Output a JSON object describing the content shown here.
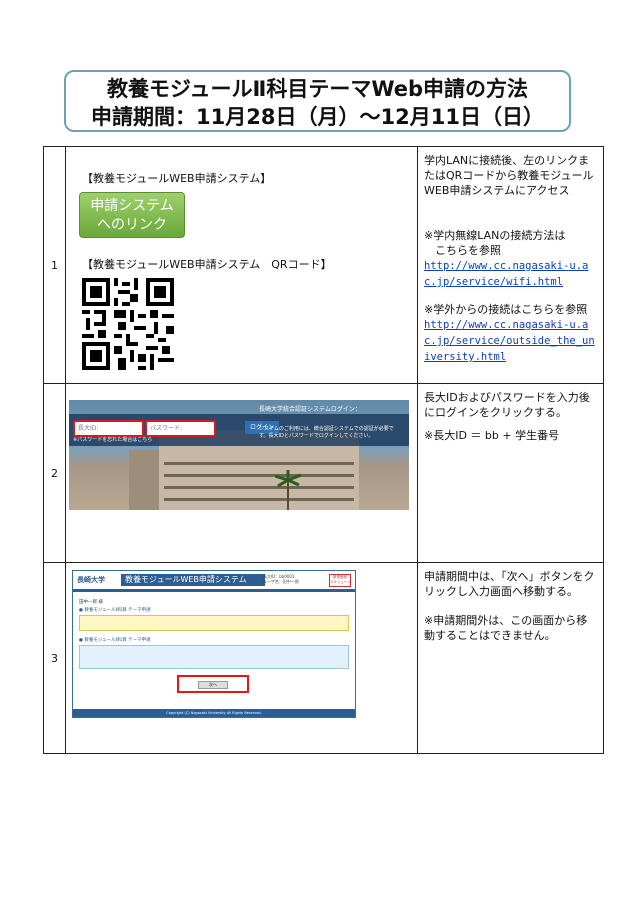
{
  "title": {
    "line1": "教養モジュールⅡ科目テーマWeb申請の方法",
    "line2": "申請期間：11月28日（月）～12月11日（日）"
  },
  "rows": [
    {
      "num": "1",
      "label_system": "【教養モジュールWEB申請システム】",
      "button_line1": "申請システム",
      "button_line2": "へのリンク",
      "label_qr": "【教養モジュールWEB申請システム　QRコード】",
      "right": {
        "p1": "学内LANに接続後、左のリンクまたはQRコードから教養モジュールWEB申請システムにアクセス",
        "p2": "※学内無線LANの接続方法は",
        "p2b": "　こちらを参照",
        "link1": "http://www.cc.nagasaki-u.ac.jp/service/wifi.html",
        "p3": "※学外からの接続はこちらを参照",
        "link2": "http://www.cc.nagasaki-u.ac.jp/service/outside_the_university.html"
      }
    },
    {
      "num": "2",
      "screenshot": {
        "id_placeholder": "長大ID:",
        "pw_placeholder": "パスワード:",
        "login_button": "ログイン",
        "heading": "長崎大学統合認証システムログイン：",
        "notice": "システムのご利用には、統合認証システムでの認証が必要です。長大IDとパスワードでログインしてください。",
        "forgot": "※パスワードを忘れた場合はこちら"
      },
      "right": {
        "p1": "長大IDおよびパスワードを入力後にログインをクリックする。",
        "p2": "※長大ID ＝ bb + 学生番号"
      }
    },
    {
      "num": "3",
      "screenshot": {
        "logo": "長崎大学",
        "app_title": "教養モジュールWEB申請システム",
        "user_info": "長大ID：bb0001\nユーザ名：田中一郎",
        "badge": "新規登録\nスケジュール",
        "user": "田中一郎 様",
        "menu1": "● 教養モジュールⅡ科目 テーマ申請",
        "menu2": "● 教養モジュールⅡ科目 テーマ申請",
        "next_button": "次へ",
        "footer": "Copyright (C) Nagasaki University All Rights Reserved."
      },
      "right": {
        "p1": "申請期間中は、「次へ」ボタンをクリックし入力画面へ移動する。",
        "p2": "※申請期間外は、この画面から移動することはできません。"
      }
    }
  ]
}
